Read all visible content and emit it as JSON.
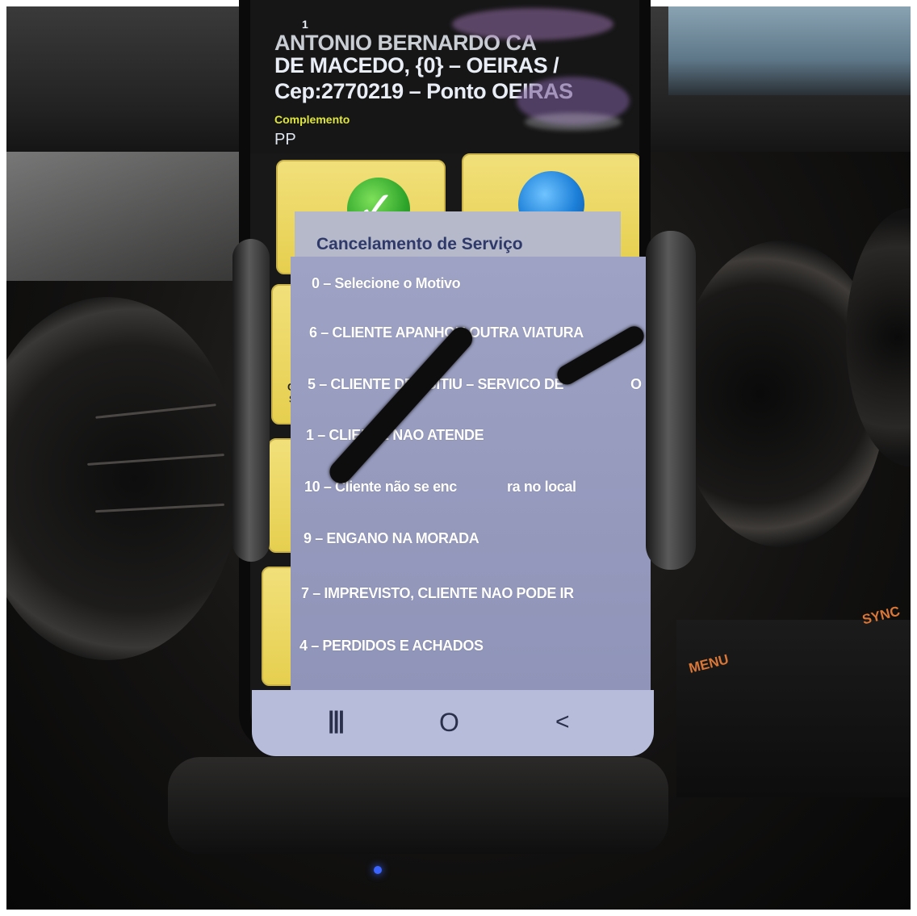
{
  "app": {
    "header": {
      "counter": "1",
      "address_line_1": "ANTONIO BERNARDO CA",
      "address_line_2": "DE MACEDO, {0} – OEIRAS /",
      "address_line_3": "Cep:2770219 – Ponto OEIRAS",
      "complemento_label": "Complemento",
      "complemento_value": "PP"
    },
    "tiles": [
      {
        "icon": "checkmark-icon",
        "color": "#2ea52b"
      },
      {
        "icon": "globe-icon",
        "color": "#1c7fd8"
      }
    ],
    "tile_label_fragments": [
      "C",
      "S"
    ]
  },
  "dialog": {
    "title": "Cancelamento de Serviço",
    "options": [
      "0 – Selecione o Motivo",
      "6 – CLIENTE APANHOU OUTRA VIATURA",
      "5 – CLIENTE DESISITIU – SERVICO DE",
      "1 – CLIENTE NAO ATENDE",
      "10 – Cliente não se enc",
      "9 – ENGANO NA MORADA",
      "7 – IMPREVISTO, CLIENTE NAO PODE IR",
      "4 – PERDIDOS E ACHADOS"
    ],
    "option_5_tail": "O",
    "option_10_tail": "ra no local"
  },
  "navbar": {
    "recent_glyph": "|||",
    "home_glyph": "O",
    "back_glyph": "<"
  },
  "car": {
    "labels": [
      "MENU",
      "SYNC"
    ],
    "accent": "#f1823a",
    "indicator_led": "#3b64ff"
  }
}
